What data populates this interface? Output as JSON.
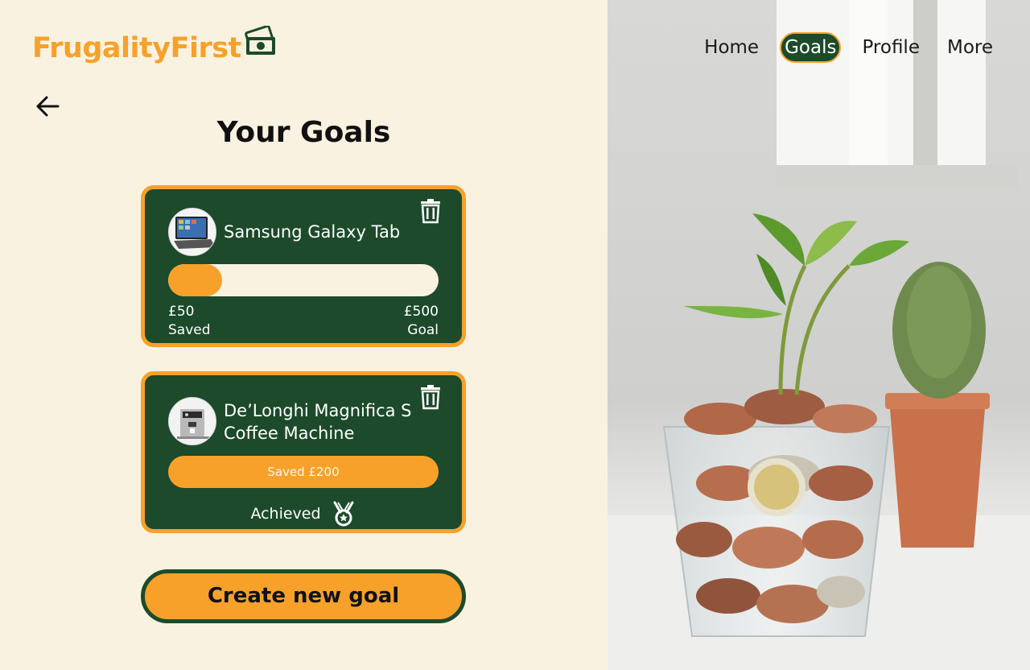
{
  "brand": {
    "name": "FrugalityFirst",
    "color_primary": "#f7a12a",
    "color_dark": "#1c4a2a",
    "logo_icon": "money-bill-icon"
  },
  "nav": {
    "items": [
      {
        "label": "Home",
        "active": false
      },
      {
        "label": "Goals",
        "active": true
      },
      {
        "label": "Profile",
        "active": false
      },
      {
        "label": "More",
        "active": false
      }
    ]
  },
  "page": {
    "title": "Your Goals",
    "back_icon": "arrow-left-icon"
  },
  "goals": [
    {
      "name": "Samsung Galaxy Tab",
      "thumbnail": "tablet-image",
      "progress": 0.1,
      "saved_amount": "£50",
      "saved_label": "Saved",
      "goal_amount": "£500",
      "goal_label": "Goal",
      "delete_icon": "trash-icon"
    },
    {
      "name": "De’Longhi Magnifica S Coffee Machine",
      "thumbnail": "coffee-machine-image",
      "saved_text": "Saved £200",
      "status": "Achieved",
      "status_icon": "medal-icon",
      "delete_icon": "trash-icon"
    }
  ],
  "actions": {
    "create_label": "Create new goal"
  },
  "hero_image": {
    "subject": "plant-growing-from-coins-in-glass"
  }
}
